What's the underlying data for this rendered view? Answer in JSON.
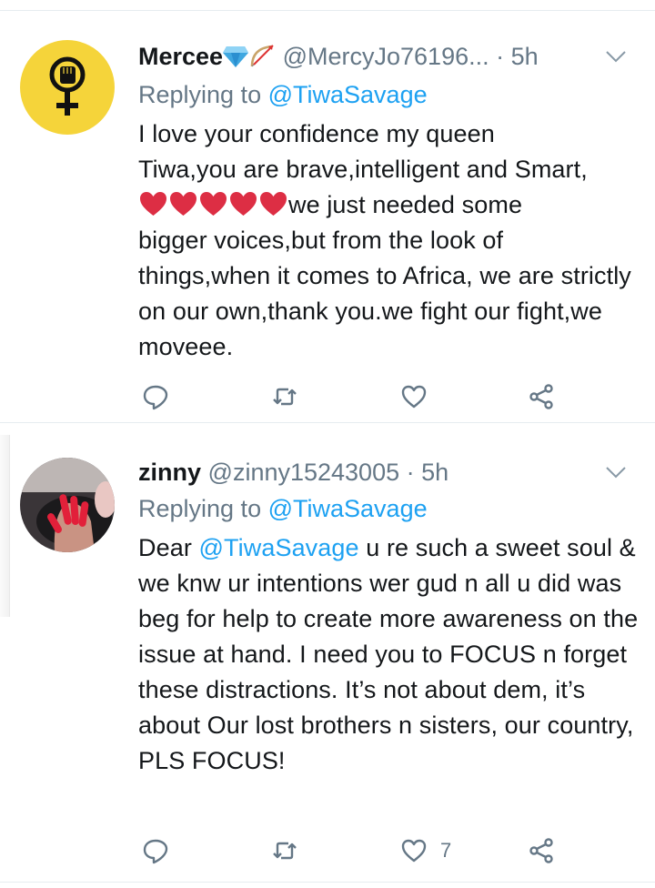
{
  "tweets": [
    {
      "display_name": "Mercee",
      "handle": "@MercyJo76196...",
      "time": "· 5h",
      "reply_prefix": "Replying to",
      "reply_to": "@TiwaSavage",
      "text_line1": "I love your confidence my queen",
      "text_line2": "Tiwa,you are brave,intelligent and Smart,",
      "text_line3_after_emoji": "we just needed some",
      "text_rest": "bigger voices,but from the look of things,when it comes to Africa, we are strictly on our own,thank you.we fight our fight,we moveee.",
      "emoji_hearts": 5,
      "like_count": ""
    },
    {
      "display_name": "zinny",
      "handle": "@zinny15243005",
      "time": "· 5h",
      "reply_prefix": "Replying to",
      "reply_to": "@TiwaSavage",
      "text_prefix": "Dear",
      "text_mention": "@TiwaSavage",
      "text_rest": " u re such a sweet soul  & we knw ur intentions wer gud n all u did was beg for help to create more awareness on the issue at hand. I need you to FOCUS n forget these distractions. It’s not about dem, it’s about Our lost brothers n sisters, our country, PLS FOCUS!",
      "like_count": "7"
    }
  ],
  "icons": {
    "reply": "reply-icon",
    "retweet": "retweet-icon",
    "like": "heart-icon",
    "share": "share-icon",
    "menu": "chevron-down-icon"
  },
  "colors": {
    "name": "#14171a",
    "secondary": "#657786",
    "link": "#1da1f2",
    "avatar_bg": "#f5d43a",
    "divider": "#e6ecf0",
    "emoji_heart": "#dd2e44"
  }
}
